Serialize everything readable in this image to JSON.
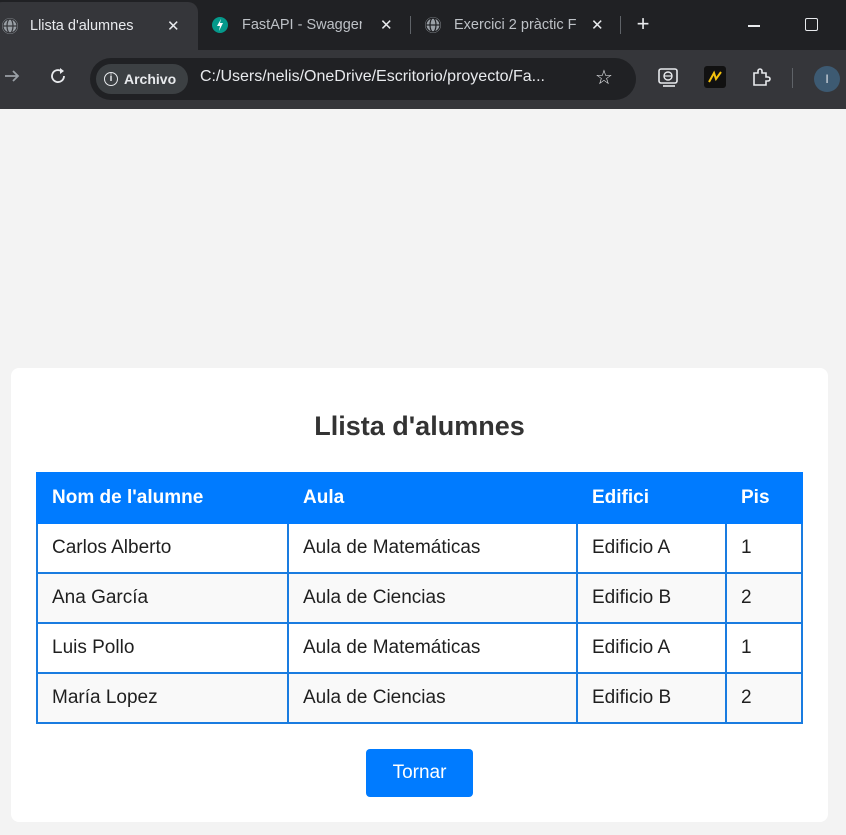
{
  "browser": {
    "tabs": [
      {
        "title": "Llista d'alumnes",
        "active": true,
        "icon": "globe-icon"
      },
      {
        "title": "FastAPI - Swagger",
        "active": false,
        "icon": "fastapi-icon"
      },
      {
        "title": "Exercici 2 pràctic F",
        "active": false,
        "icon": "globe-icon"
      }
    ],
    "tab_close": "✕",
    "new_tab": "+",
    "chip_label": "Archivo",
    "url": "C:/Users/nelis/OneDrive/Escritorio/proyecto/Fa...",
    "profile_initial": "I"
  },
  "page": {
    "title": "Llista d'alumnes",
    "columns": [
      "Nom de l'alumne",
      "Aula",
      "Edifici",
      "Pis"
    ],
    "rows": [
      [
        "Carlos Alberto",
        "Aula de Matemáticas",
        "Edificio A",
        "1"
      ],
      [
        "Ana García",
        "Aula de Ciencias",
        "Edificio B",
        "2"
      ],
      [
        "Luis Pollo",
        "Aula de Matemáticas",
        "Edificio A",
        "1"
      ],
      [
        "María Lopez",
        "Aula de Ciencias",
        "Edificio B",
        "2"
      ]
    ],
    "back_button": "Tornar"
  },
  "colors": {
    "accent": "#007bff",
    "header_text": "#ffffff",
    "background": "#f3f3f3"
  }
}
